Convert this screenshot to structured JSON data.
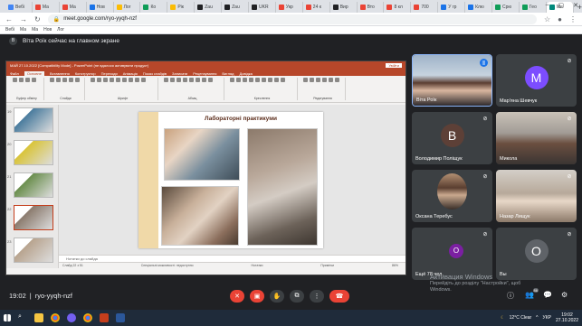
{
  "browser": {
    "tabs": [
      {
        "label": "Вебі",
        "color": "#4285f4"
      },
      {
        "label": "Ма",
        "color": "#ea4335"
      },
      {
        "label": "Ма",
        "color": "#ea4335"
      },
      {
        "label": "Нов",
        "color": "#1a73e8"
      },
      {
        "label": "Лог",
        "color": "#fbbc04"
      },
      {
        "label": "Ко",
        "color": "#0f9d58"
      },
      {
        "label": "Рік",
        "color": "#fbbc04"
      },
      {
        "label": "Zau",
        "color": "#202124"
      },
      {
        "label": "Zau",
        "color": "#202124"
      },
      {
        "label": "UKR",
        "color": "#202124"
      },
      {
        "label": "Укр",
        "color": "#ea4335"
      },
      {
        "label": "24 к",
        "color": "#ea4335"
      },
      {
        "label": "Вир",
        "color": "#202124"
      },
      {
        "label": "Вто",
        "color": "#ea4335"
      },
      {
        "label": "8 кл",
        "color": "#ea4335"
      },
      {
        "label": "700",
        "color": "#ea4335"
      },
      {
        "label": "У гр",
        "color": "#1a73e8"
      },
      {
        "label": "Клю",
        "color": "#1a73e8"
      },
      {
        "label": "Срю",
        "color": "#0f9d58"
      },
      {
        "label": "Гео",
        "color": "#0f9d58"
      },
      {
        "label": "Ме",
        "color": "#00897b"
      }
    ],
    "new_tab": "+",
    "url": "meet.google.com/ryo-yyqh-nzf",
    "bookmarks": [
      "Вебі",
      "Ма",
      "Ма",
      "Нов",
      "Лог"
    ]
  },
  "meet": {
    "presenter_initial": "В",
    "presenter_text": "Віта Роїк сейчас на главном экране",
    "meeting_time": "19:02",
    "meeting_code": "ryo-yyqh-nzf",
    "participants_badge": "86",
    "participants": [
      {
        "name": "Віта Роїк",
        "initial": "",
        "avatar_color": "",
        "active": true
      },
      {
        "name": "Мар'яна Шевчук",
        "initial": "М",
        "avatar_color": "#7c4dff"
      },
      {
        "name": "Володимир Поліщук",
        "initial": "В",
        "avatar_color": "#5d4037"
      },
      {
        "name": "Микола",
        "initial": "",
        "avatar_color": ""
      },
      {
        "name": "Оксана Теребус",
        "initial": "",
        "avatar_color": ""
      },
      {
        "name": "Назар Лищук",
        "initial": "",
        "avatar_color": ""
      },
      {
        "name": "Ещё 78 чел.",
        "initial": "О",
        "avatar_color": "#7b1fa2"
      },
      {
        "name": "Вы",
        "initial": "О",
        "avatar_color": "#5f6368"
      }
    ],
    "activation_title": "Активация Windows",
    "activation_sub1": "Перейдіть до розділу \"Настройки\", щоб",
    "activation_sub2": "Windows."
  },
  "powerpoint": {
    "title_bar": "МАЙ 27.10.2022 [Compatibility Mode] - PowerPoint (не вдалося активувати продукт)",
    "sign_in": "Увійти",
    "menu": [
      "Файл",
      "Основне",
      "Вставлення",
      "Конструктор",
      "Переходи",
      "Анімація",
      "Показ слайдів",
      "Записати",
      "Рецензування",
      "Вигляд",
      "Довідка"
    ],
    "menu_active": "Основне",
    "ribbon_groups": [
      "Буфер обміну",
      "Слайди",
      "Шрифт",
      "Абзац",
      "Креслення",
      "Редагування"
    ],
    "ribbon_labels": {
      "paste": "Вставити",
      "new_slide": "Створити слайд",
      "find": "Знайти",
      "replace": "Замінити",
      "select": "Виділити"
    },
    "thumb_numbers": [
      "19",
      "20",
      "21",
      "22",
      "23"
    ],
    "slide_title": "Лабораторні практикуми",
    "notes_placeholder": "Нотатки до слайда",
    "status_left": "Слайд 22 з 51",
    "status_accessibility": "Спеціальні можливості: недоступно",
    "status_notes": "Нотатки",
    "status_comments": "Примітки",
    "zoom": "86%"
  },
  "taskbar": {
    "weather": "12°C Clear",
    "lang": "УКР",
    "time": "19:02",
    "date": "27.10.2022"
  }
}
